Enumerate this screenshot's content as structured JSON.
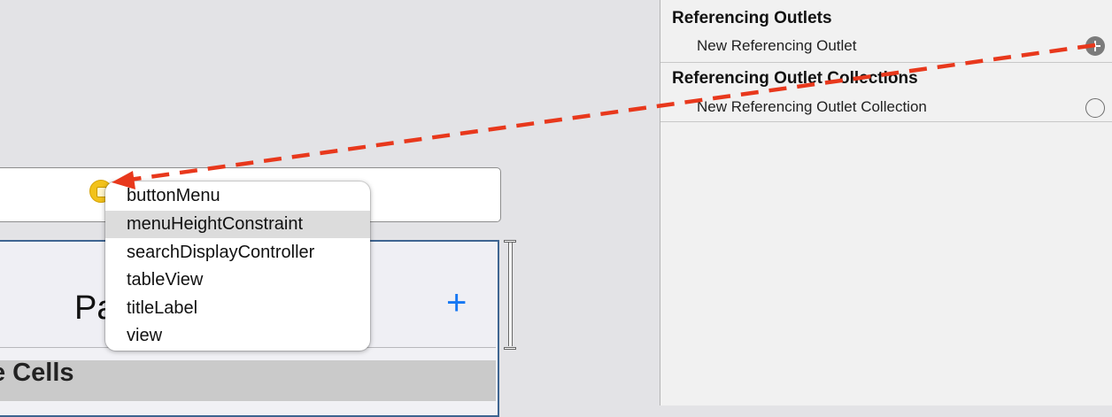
{
  "canvas": {
    "nav_title": "Pa",
    "nav_add_icon": "plus-icon",
    "section_header": "e Cells",
    "view_controller_icon": "view-controller-icon"
  },
  "outlet_menu": {
    "items": [
      {
        "label": "buttonMenu",
        "selected": false
      },
      {
        "label": "menuHeightConstraint",
        "selected": true
      },
      {
        "label": "searchDisplayController",
        "selected": false
      },
      {
        "label": "tableView",
        "selected": false
      },
      {
        "label": "titleLabel",
        "selected": false
      },
      {
        "label": "view",
        "selected": false
      }
    ]
  },
  "inspector": {
    "referencing_outlets": {
      "title": "Referencing Outlets",
      "row": "New Referencing Outlet",
      "icon": "add-connection-icon"
    },
    "referencing_outlet_collections": {
      "title": "Referencing Outlet Collections",
      "row": "New Referencing Outlet Collection",
      "icon": "empty-connection-icon"
    }
  },
  "colors": {
    "drag_arrow": "#e8381c",
    "accent_blue": "#1577f3",
    "view_controller_yellow": "#f2c21a",
    "selection_highlight": "#dcdcdc"
  }
}
